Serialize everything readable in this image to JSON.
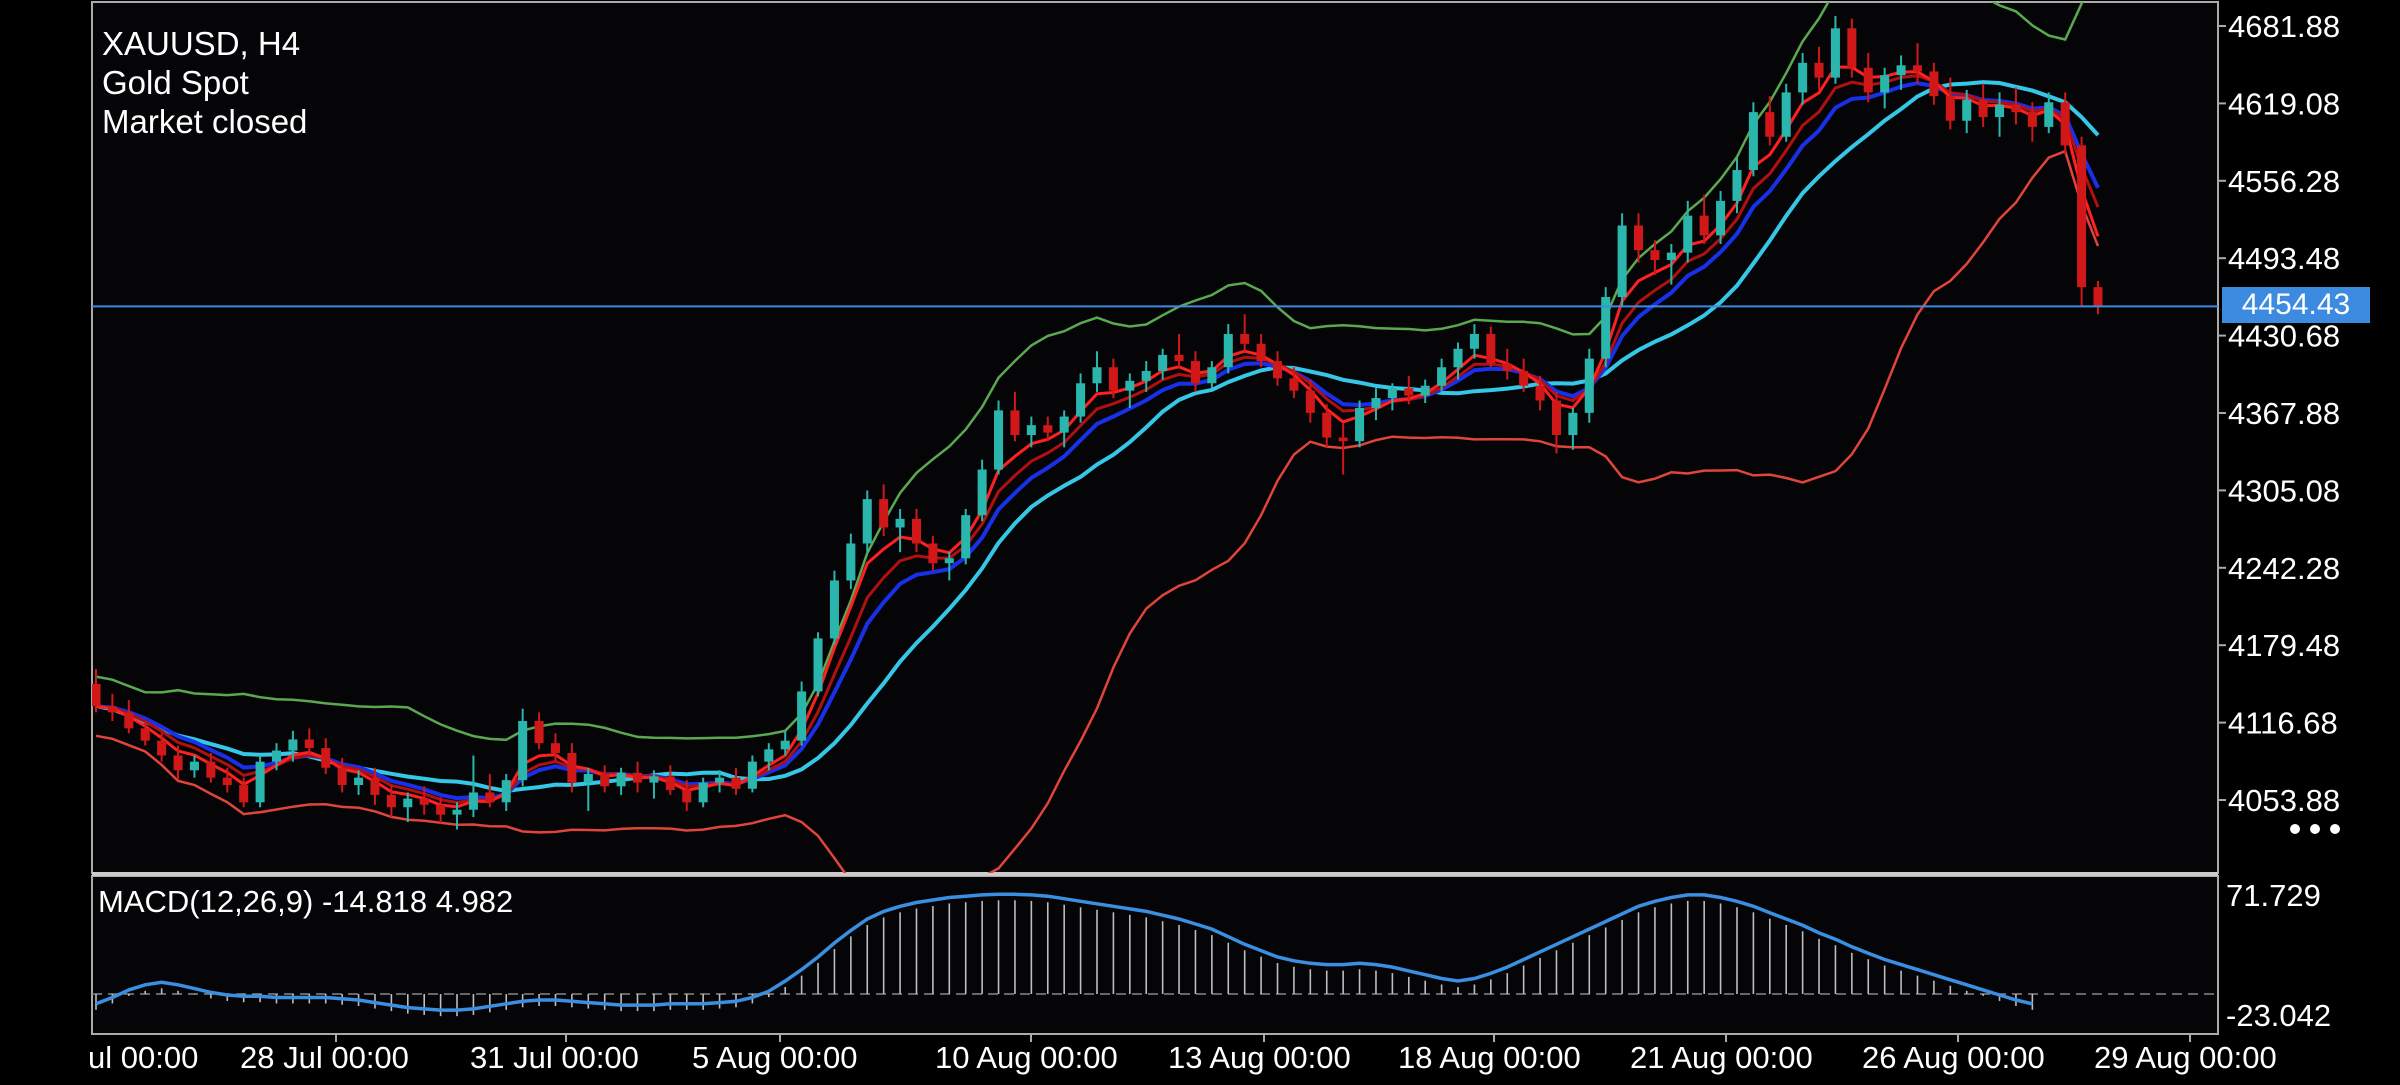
{
  "symbol": {
    "label": "XAUUSD, H4",
    "name": "Gold Spot",
    "status": "Market closed"
  },
  "current_price": "4454.43",
  "menu_icon": "more-dots-icon",
  "colors": {
    "background": "#050508",
    "frame": "#aaaaaa",
    "candle_up": "#2bb6ad",
    "candle_down": "#d01818",
    "band_upper": "#5aa850",
    "band_lower": "#e0443a",
    "ma_fast": "#ff2020",
    "ma_mid": "#b01010",
    "ma_blue": "#1830e8",
    "ma_cyan": "#36c6e6",
    "price_line": "#3d8be0",
    "macd_line": "#3a8fe0",
    "macd_hist": "#bdbdbd"
  },
  "chart_data": [
    {
      "type": "candlestick",
      "title": "XAUUSD, H4",
      "y_ticks": [
        "4681.88",
        "4619.08",
        "4556.28",
        "4493.48",
        "4430.68",
        "4367.88",
        "4305.08",
        "4242.28",
        "4179.48",
        "4116.68",
        "4053.88"
      ],
      "x_ticks": [
        "ul 00:00",
        "28 Jul 00:00",
        "31 Jul 00:00",
        "5 Aug 00:00",
        "10 Aug 00:00",
        "13 Aug 00:00",
        "18 Aug 00:00",
        "21 Aug 00:00",
        "26 Aug 00:00",
        "29 Aug 00:00"
      ],
      "ylim": [
        4020,
        4700
      ],
      "price_line": 4454.43,
      "grid": false,
      "candles": [
        [
          4148,
          4160,
          4125,
          4130
        ],
        [
          4130,
          4140,
          4118,
          4125
        ],
        [
          4125,
          4135,
          4108,
          4112
        ],
        [
          4112,
          4118,
          4098,
          4102
        ],
        [
          4102,
          4108,
          4085,
          4090
        ],
        [
          4090,
          4098,
          4070,
          4078
        ],
        [
          4078,
          4090,
          4072,
          4085
        ],
        [
          4085,
          4092,
          4068,
          4072
        ],
        [
          4072,
          4080,
          4060,
          4066
        ],
        [
          4066,
          4072,
          4048,
          4052
        ],
        [
          4052,
          4090,
          4048,
          4085
        ],
        [
          4085,
          4100,
          4078,
          4094
        ],
        [
          4094,
          4110,
          4085,
          4103
        ],
        [
          4103,
          4112,
          4090,
          4096
        ],
        [
          4096,
          4104,
          4075,
          4080
        ],
        [
          4080,
          4088,
          4060,
          4066
        ],
        [
          4066,
          4078,
          4058,
          4072
        ],
        [
          4072,
          4080,
          4050,
          4058
        ],
        [
          4058,
          4066,
          4040,
          4048
        ],
        [
          4048,
          4060,
          4036,
          4055
        ],
        [
          4055,
          4065,
          4042,
          4050
        ],
        [
          4050,
          4056,
          4035,
          4042
        ],
        [
          4042,
          4052,
          4030,
          4046
        ],
        [
          4046,
          4090,
          4040,
          4060
        ],
        [
          4060,
          4075,
          4048,
          4052
        ],
        [
          4052,
          4075,
          4045,
          4070
        ],
        [
          4070,
          4128,
          4065,
          4118
        ],
        [
          4118,
          4125,
          4095,
          4100
        ],
        [
          4100,
          4108,
          4085,
          4092
        ],
        [
          4092,
          4100,
          4060,
          4068
        ],
        [
          4068,
          4080,
          4045,
          4075
        ],
        [
          4075,
          4082,
          4060,
          4065
        ],
        [
          4065,
          4080,
          4058,
          4076
        ],
        [
          4076,
          4085,
          4060,
          4068
        ],
        [
          4068,
          4078,
          4055,
          4073
        ],
        [
          4073,
          4082,
          4058,
          4062
        ],
        [
          4062,
          4070,
          4045,
          4052
        ],
        [
          4052,
          4072,
          4048,
          4068
        ],
        [
          4068,
          4078,
          4060,
          4072
        ],
        [
          4072,
          4080,
          4058,
          4063
        ],
        [
          4063,
          4090,
          4060,
          4085
        ],
        [
          4085,
          4100,
          4078,
          4095
        ],
        [
          4095,
          4110,
          4090,
          4102
        ],
        [
          4102,
          4150,
          4098,
          4142
        ],
        [
          4142,
          4190,
          4138,
          4185
        ],
        [
          4185,
          4240,
          4180,
          4232
        ],
        [
          4232,
          4270,
          4225,
          4262
        ],
        [
          4262,
          4305,
          4255,
          4298
        ],
        [
          4298,
          4310,
          4268,
          4275
        ],
        [
          4275,
          4290,
          4255,
          4282
        ],
        [
          4282,
          4290,
          4255,
          4262
        ],
        [
          4262,
          4268,
          4240,
          4246
        ],
        [
          4246,
          4255,
          4232,
          4250
        ],
        [
          4250,
          4290,
          4245,
          4285
        ],
        [
          4285,
          4330,
          4280,
          4322
        ],
        [
          4322,
          4378,
          4318,
          4370
        ],
        [
          4370,
          4385,
          4345,
          4350
        ],
        [
          4350,
          4365,
          4340,
          4358
        ],
        [
          4358,
          4365,
          4345,
          4352
        ],
        [
          4352,
          4370,
          4340,
          4365
        ],
        [
          4365,
          4400,
          4360,
          4392
        ],
        [
          4392,
          4418,
          4385,
          4405
        ],
        [
          4405,
          4412,
          4380,
          4386
        ],
        [
          4386,
          4400,
          4372,
          4394
        ],
        [
          4394,
          4410,
          4385,
          4402
        ],
        [
          4402,
          4420,
          4395,
          4415
        ],
        [
          4415,
          4432,
          4405,
          4410
        ],
        [
          4410,
          4418,
          4385,
          4392
        ],
        [
          4392,
          4410,
          4388,
          4405
        ],
        [
          4405,
          4440,
          4400,
          4432
        ],
        [
          4432,
          4448,
          4418,
          4424
        ],
        [
          4424,
          4432,
          4405,
          4410
        ],
        [
          4410,
          4418,
          4390,
          4396
        ],
        [
          4396,
          4405,
          4380,
          4386
        ],
        [
          4386,
          4395,
          4360,
          4368
        ],
        [
          4368,
          4375,
          4340,
          4348
        ],
        [
          4348,
          4360,
          4318,
          4345
        ],
        [
          4345,
          4378,
          4340,
          4372
        ],
        [
          4372,
          4388,
          4362,
          4380
        ],
        [
          4380,
          4392,
          4370,
          4388
        ],
        [
          4388,
          4398,
          4375,
          4382
        ],
        [
          4382,
          4395,
          4376,
          4390
        ],
        [
          4390,
          4412,
          4385,
          4405
        ],
        [
          4405,
          4425,
          4395,
          4420
        ],
        [
          4420,
          4440,
          4412,
          4432
        ],
        [
          4432,
          4438,
          4405,
          4408
        ],
        [
          4408,
          4420,
          4395,
          4402
        ],
        [
          4402,
          4412,
          4385,
          4390
        ],
        [
          4390,
          4398,
          4370,
          4378
        ],
        [
          4378,
          4385,
          4335,
          4350
        ],
        [
          4350,
          4372,
          4338,
          4368
        ],
        [
          4368,
          4420,
          4360,
          4412
        ],
        [
          4412,
          4470,
          4405,
          4462
        ],
        [
          4462,
          4530,
          4455,
          4520
        ],
        [
          4520,
          4530,
          4490,
          4500
        ],
        [
          4500,
          4508,
          4480,
          4492
        ],
        [
          4492,
          4505,
          4472,
          4498
        ],
        [
          4498,
          4540,
          4490,
          4528
        ],
        [
          4528,
          4545,
          4505,
          4512
        ],
        [
          4512,
          4548,
          4505,
          4540
        ],
        [
          4540,
          4575,
          4530,
          4565
        ],
        [
          4565,
          4620,
          4560,
          4612
        ],
        [
          4612,
          4625,
          4585,
          4592
        ],
        [
          4592,
          4635,
          4588,
          4628
        ],
        [
          4628,
          4660,
          4618,
          4652
        ],
        [
          4652,
          4665,
          4630,
          4640
        ],
        [
          4640,
          4690,
          4635,
          4680
        ],
        [
          4680,
          4688,
          4640,
          4648
        ],
        [
          4648,
          4660,
          4620,
          4628
        ],
        [
          4628,
          4648,
          4615,
          4642
        ],
        [
          4642,
          4658,
          4630,
          4650
        ],
        [
          4650,
          4668,
          4635,
          4645
        ],
        [
          4645,
          4652,
          4618,
          4625
        ],
        [
          4625,
          4640,
          4598,
          4605
        ],
        [
          4605,
          4630,
          4595,
          4622
        ],
        [
          4622,
          4635,
          4600,
          4608
        ],
        [
          4608,
          4628,
          4592,
          4618
        ],
        [
          4618,
          4632,
          4602,
          4612
        ],
        [
          4612,
          4620,
          4588,
          4600
        ],
        [
          4600,
          4628,
          4595,
          4620
        ],
        [
          4620,
          4628,
          4578,
          4585
        ],
        [
          4585,
          4592,
          4455,
          4470
        ],
        [
          4470,
          4475,
          4448,
          4454
        ]
      ]
    },
    {
      "type": "macd",
      "label": "MACD(12,26,9) -14.818 4.982",
      "y_ticks": [
        "71.729",
        "-23.042"
      ],
      "ylim": [
        -23.042,
        71.729
      ],
      "signal": [
        -15,
        -10,
        -4,
        0,
        2,
        0,
        -3,
        -6,
        -8,
        -9,
        -9,
        -10,
        -10,
        -10,
        -10,
        -11,
        -12,
        -14,
        -16,
        -18,
        -19,
        -20,
        -20,
        -19,
        -17,
        -15,
        -13,
        -12,
        -12,
        -13,
        -14,
        -15,
        -16,
        -16,
        -16,
        -15,
        -15,
        -15,
        -14,
        -13,
        -10,
        -5,
        3,
        12,
        22,
        33,
        43,
        52,
        58,
        62,
        65,
        67,
        69,
        70,
        71,
        71.5,
        71.5,
        71,
        70,
        68,
        66,
        64,
        62,
        60,
        58,
        55,
        52,
        48,
        44,
        38,
        32,
        27,
        22,
        19,
        17,
        16,
        16,
        17,
        16,
        14,
        11,
        8,
        5,
        3,
        5,
        9,
        14,
        20,
        26,
        32,
        38,
        44,
        50,
        56,
        62,
        66,
        69,
        71,
        71,
        69,
        66,
        62,
        57,
        52,
        47,
        41,
        36,
        30,
        25,
        20,
        16,
        12,
        8,
        4,
        0,
        -4,
        -8,
        -12,
        -15
      ]
    }
  ]
}
